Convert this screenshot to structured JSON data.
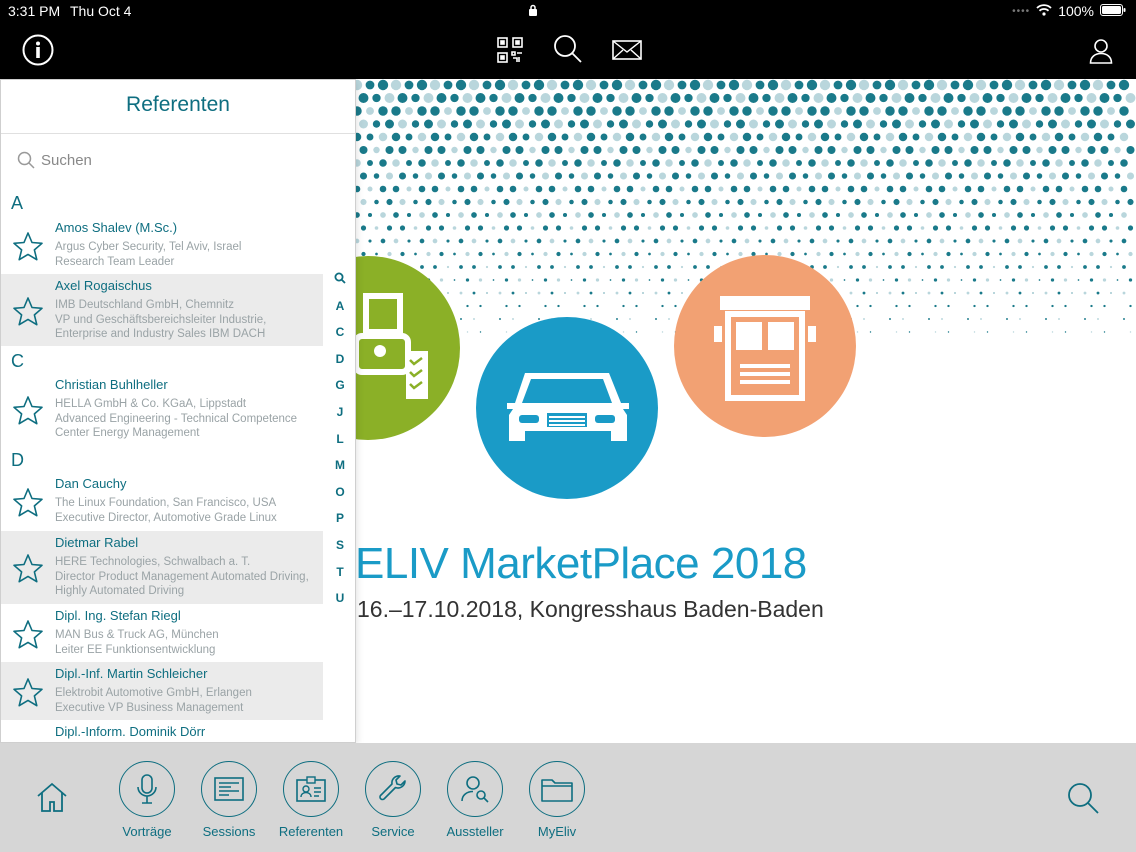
{
  "status_bar": {
    "time": "3:31 PM",
    "date": "Thu Oct 4",
    "battery": "100%"
  },
  "top_bar": {
    "icons": [
      "info-icon",
      "qr-code-icon",
      "search-icon",
      "mail-icon",
      "user-icon"
    ]
  },
  "banner": {
    "event_title": "ELIV MarketPlace 2018",
    "event_subtitle": "16.–17.10.2018, Kongresshaus Baden-Baden",
    "colors": {
      "green": "#8bb027",
      "blue": "#1a9bc7",
      "orange": "#f2a173",
      "dots": "#1a7a8a"
    }
  },
  "popover": {
    "title": "Referenten",
    "search_placeholder": "Suchen",
    "sections": [
      {
        "letter": "A",
        "items": [
          {
            "name": "Amos Shalev (M.Sc.)",
            "details": [
              "Argus Cyber Security, Tel Aviv, Israel",
              "Research Team Leader"
            ]
          },
          {
            "name": "Axel Rogaischus",
            "details": [
              "IMB Deutschland GmbH, Chemnitz",
              "VP und Geschäftsbereichsleiter Industrie,",
              "Enterprise and Industry Sales IBM DACH"
            ]
          }
        ]
      },
      {
        "letter": "C",
        "items": [
          {
            "name": "Christian Buhlheller",
            "details": [
              "HELLA GmbH & Co. KGaA, Lippstadt",
              "Advanced Engineering - Technical Competence",
              "Center Energy Management"
            ]
          }
        ]
      },
      {
        "letter": "D",
        "items": [
          {
            "name": "Dan Cauchy",
            "details": [
              "The Linux Foundation, San Francisco, USA",
              "Executive Director, Automotive Grade Linux"
            ]
          },
          {
            "name": "Dietmar Rabel",
            "details": [
              "HERE Technologies, Schwalbach a. T.",
              "Director Product Management Automated Driving,",
              "Highly Automated Driving"
            ]
          },
          {
            "name": "Dipl. Ing. Stefan Riegl",
            "details": [
              "MAN Bus & Truck AG, München",
              "Leiter EE Funktionsentwicklung"
            ]
          },
          {
            "name": "Dipl.-Inf. Martin Schleicher",
            "details": [
              "Elektrobit Automotive GmbH, Erlangen",
              "Executive VP Business Management"
            ]
          },
          {
            "name": "Dipl.-Inform. Dominik Dörr",
            "details": []
          }
        ]
      }
    ],
    "index_letters": [
      "Q",
      "A",
      "C",
      "D",
      "G",
      "J",
      "L",
      "M",
      "O",
      "P",
      "S",
      "T",
      "U"
    ]
  },
  "tab_bar": {
    "tabs": [
      {
        "label": "Vorträge",
        "icon": "microphone-icon"
      },
      {
        "label": "Sessions",
        "icon": "sessions-icon"
      },
      {
        "label": "Referenten",
        "icon": "badge-icon"
      },
      {
        "label": "Service",
        "icon": "wrench-icon"
      },
      {
        "label": "Aussteller",
        "icon": "exhibitor-icon"
      },
      {
        "label": "MyEliv",
        "icon": "folder-icon"
      }
    ],
    "home_icon": "home-icon",
    "search_icon": "search-icon"
  }
}
